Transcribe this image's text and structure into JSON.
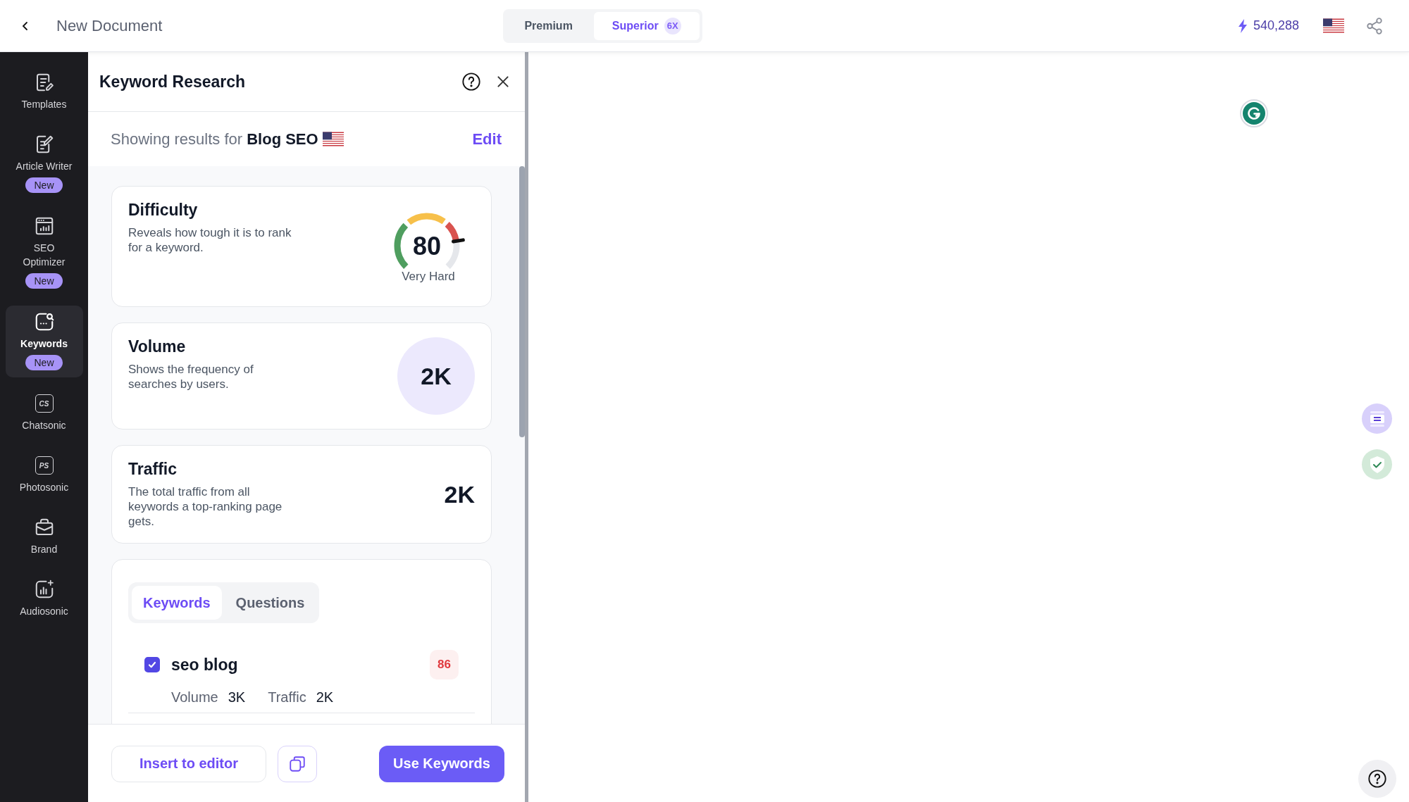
{
  "topbar": {
    "title": "New Document",
    "plans": [
      {
        "label": "Premium",
        "selected": false
      },
      {
        "label": "Superior",
        "badge": "6X",
        "selected": true
      }
    ],
    "credits": "540,288"
  },
  "sidebar": {
    "items": [
      {
        "label": "Templates",
        "selected": false
      },
      {
        "label": "Article Writer",
        "badge": "New",
        "selected": false
      },
      {
        "label": "SEO Optimizer",
        "badge": "New",
        "selected": false
      },
      {
        "label": "Keywords",
        "badge": "New",
        "selected": true
      },
      {
        "label": "Chatsonic",
        "glyph": "CS",
        "selected": false
      },
      {
        "label": "Photosonic",
        "glyph": "PS",
        "selected": false
      },
      {
        "label": "Brand",
        "selected": false
      },
      {
        "label": "Audiosonic",
        "selected": false
      }
    ]
  },
  "panel": {
    "title": "Keyword Research",
    "summary": "Showing results for **Blog SEO**",
    "edit": "Edit",
    "metrics": [
      {
        "kind": "gauge",
        "title": "Difficulty",
        "description": "Reveals how tough it is to rank for a keyword.",
        "value": "80",
        "level": 0.8,
        "rating": "Very Hard"
      },
      {
        "kind": "circle",
        "title": "Volume",
        "description": "Shows the frequency of searches by users.",
        "value": "2K"
      },
      {
        "kind": "plain",
        "title": "Traffic",
        "description": "The total traffic from all keywords a top-ranking page gets.",
        "value": "2K"
      }
    ],
    "tabs": [
      {
        "label": "Keywords",
        "selected": true
      },
      {
        "label": "Questions",
        "selected": false
      }
    ],
    "keywords": [
      {
        "keyword": "seo blog",
        "checked": true,
        "score": "86",
        "stats": [
          {
            "label": "Volume",
            "value": "3K"
          },
          {
            "label": "Traffic",
            "value": "2K"
          }
        ]
      }
    ],
    "actions": {
      "insert": "Insert to editor",
      "use": "Use Keywords"
    }
  }
}
